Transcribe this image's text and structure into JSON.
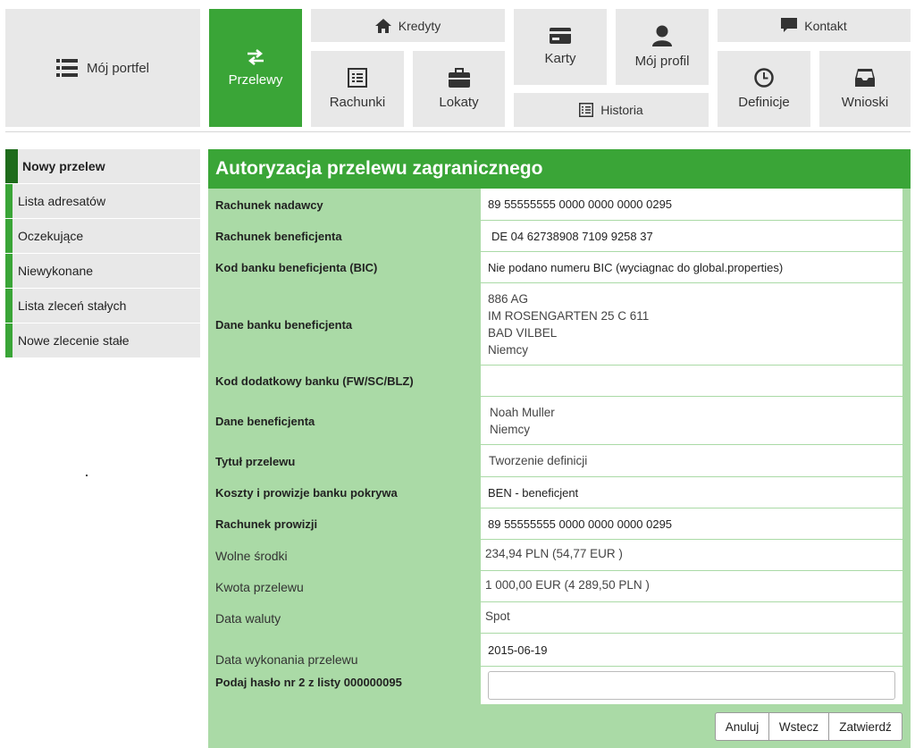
{
  "nav": {
    "portfel": "Mój portfel",
    "przelewy": "Przelewy",
    "kredyty": "Kredyty",
    "rachunki": "Rachunki",
    "lokaty": "Lokaty",
    "karty": "Karty",
    "profil": "Mój profil",
    "historia": "Historia",
    "kontakt": "Kontakt",
    "definicje": "Definicje",
    "wnioski": "Wnioski"
  },
  "sidebar": {
    "items": [
      {
        "label": "Nowy przelew"
      },
      {
        "label": "Lista adresatów"
      },
      {
        "label": "Oczekujące"
      },
      {
        "label": "Niewykonane"
      },
      {
        "label": "Lista zleceń stałych"
      },
      {
        "label": "Nowe zlecenie stałe"
      }
    ]
  },
  "panel": {
    "title": "Autoryzacja przelewu zagranicznego",
    "rows": {
      "nadawca": {
        "label": "Rachunek nadawcy",
        "value": "89 55555555 0000 0000 0000 0295"
      },
      "beneficjent": {
        "label": "Rachunek beneficjenta",
        "value": "DE 04 62738908 7109 9258 37"
      },
      "bic": {
        "label": "Kod banku beneficjenta (BIC)",
        "value": "Nie podano numeru BIC (wyciagnac do global.properties)"
      },
      "bank": {
        "label": "Dane banku beneficjenta",
        "lines": [
          "886 AG",
          "IM ROSENGARTEN 25 C 611",
          "BAD VILBEL",
          "Niemcy"
        ]
      },
      "kod_dod": {
        "label": "Kod dodatkowy banku (FW/SC/BLZ)",
        "value": ""
      },
      "dane_ben": {
        "label": "Dane beneficjenta",
        "lines": [
          "Noah Muller",
          "Niemcy"
        ]
      },
      "tytul": {
        "label": "Tytuł przelewu",
        "value": "Tworzenie definicji"
      },
      "koszty": {
        "label": "Koszty i prowizje banku pokrywa",
        "value": "BEN - beneficjent"
      },
      "prowizja": {
        "label": "Rachunek prowizji",
        "value": "89 55555555 0000 0000 0000 0295"
      },
      "srodki": {
        "label": "Wolne środki",
        "value": "234,94 PLN (54,77 EUR )"
      },
      "kwota": {
        "label": "Kwota przelewu",
        "value": "1 000,00 EUR (4 289,50 PLN )"
      },
      "waluta": {
        "label": "Data waluty",
        "value": "Spot"
      },
      "wykonanie": {
        "label": "Data wykonania przelewu",
        "value": "2015-06-19"
      },
      "haslo": {
        "label": "Podaj hasło nr 2 z listy 000000095",
        "value": ""
      }
    },
    "buttons": {
      "cancel": "Anuluj",
      "back": "Wstecz",
      "confirm": "Zatwierdź"
    }
  }
}
